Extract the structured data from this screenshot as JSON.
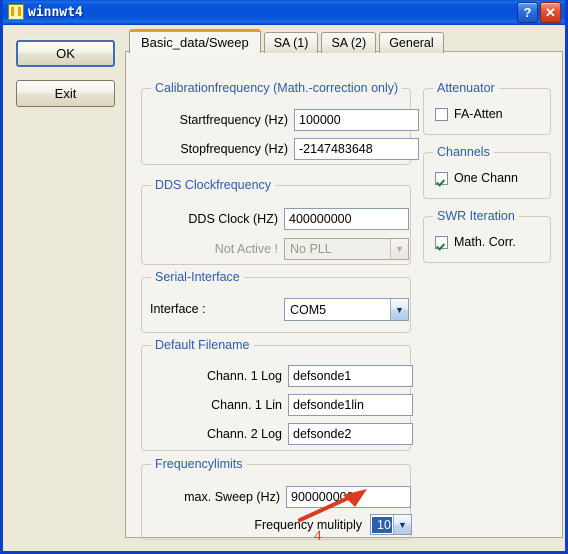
{
  "window": {
    "title": "winnwt4",
    "icon": "app-icon",
    "help_label": "?",
    "close_label": "✕",
    "accent_titlebar": "#0A56D6",
    "bg_dialog": "#ECE9D8",
    "bg_tabpanel": "#F4F3EF",
    "group_label_color": "#2B5EA8"
  },
  "left_buttons": [
    {
      "label": "OK"
    },
    {
      "label": "Exit"
    }
  ],
  "tabs": [
    {
      "label": "Basic_data/Sweep",
      "active": true
    },
    {
      "label": "SA (1)",
      "active": false
    },
    {
      "label": "SA (2)",
      "active": false
    },
    {
      "label": "General",
      "active": false
    }
  ],
  "groups": {
    "calibration": {
      "title": "Calibrationfrequency (Math.-correction only)",
      "fields": [
        {
          "label": "Startfrequency (Hz)",
          "value": "100000"
        },
        {
          "label": "Stopfrequency (Hz)",
          "value": "-2147483648"
        }
      ]
    },
    "dds": {
      "title": "DDS Clockfrequency",
      "clock_label": "DDS Clock (HZ)",
      "clock_value": "400000000",
      "pll_label": "Not Active !",
      "pll_value": "No PLL",
      "pll_disabled": true
    },
    "serial": {
      "title": "Serial-Interface",
      "interface_label": "Interface :",
      "interface_value": "COM5"
    },
    "filenames": {
      "title": "Default Filename",
      "fields": [
        {
          "label": "Chann. 1  Log",
          "value": "defsonde1"
        },
        {
          "label": "Chann. 1  Lin",
          "value": "defsonde1lin"
        },
        {
          "label": "Chann. 2 Log",
          "value": "defsonde2"
        }
      ]
    },
    "freqlimits": {
      "title": "Frequencylimits",
      "sweep_label": "max. Sweep (Hz)",
      "sweep_value": "900000000",
      "multiply_label": "Frequency mulitiply",
      "multiply_value": "10",
      "multiply_selected": true
    },
    "attenuator": {
      "title": "Attenuator",
      "checkbox_label": "FA-Atten",
      "checked": false
    },
    "channels": {
      "title": "Channels",
      "checkbox_label": "One Chann",
      "checked": true
    },
    "swr": {
      "title": "SWR Iteration",
      "checkbox_label": "Math. Corr.",
      "checked": true
    }
  },
  "annotations": {
    "step_number": "4",
    "arrow_color": "#D93A20",
    "arrow_target": "frequency-multiply-combo"
  }
}
